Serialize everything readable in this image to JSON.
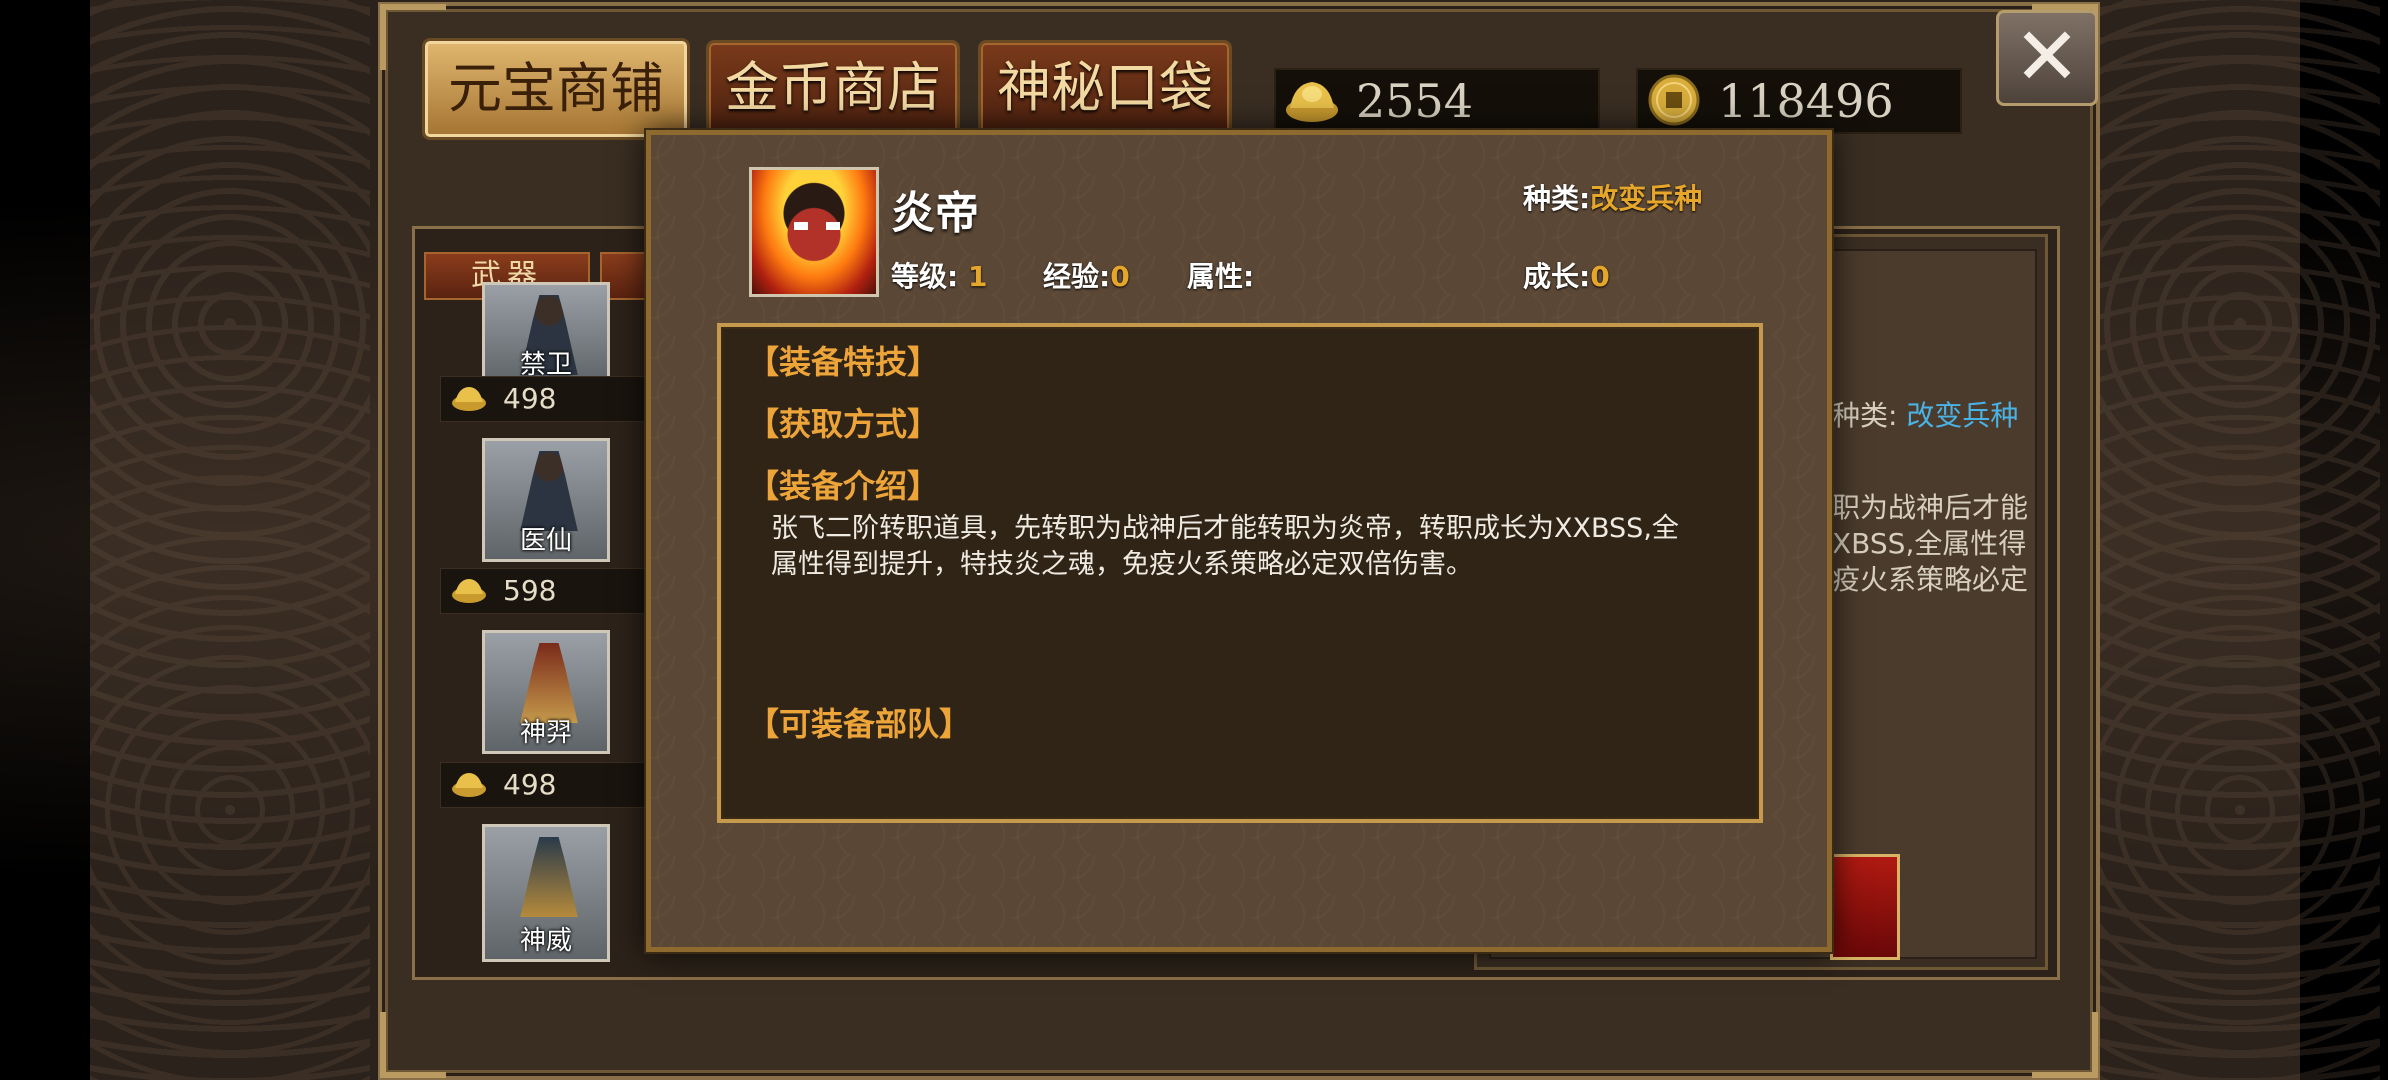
{
  "shop": {
    "tabs": [
      {
        "label": "元宝商铺",
        "active": true
      },
      {
        "label": "金币商店",
        "active": false
      },
      {
        "label": "神秘口袋",
        "active": false
      }
    ],
    "yuanbao": "2554",
    "gold_coins": "118496",
    "close_icon": "✕",
    "categories": [
      "武器"
    ],
    "items": [
      {
        "name": "禁卫",
        "price": "498"
      },
      {
        "name": "医仙",
        "price": "598"
      },
      {
        "name": "神羿",
        "price": "498"
      },
      {
        "name": "神威",
        "price": ""
      }
    ],
    "right_peek": {
      "type_label": "种类:",
      "type_value": "改变兵种",
      "lines": [
        "职为战神后才能",
        "XBSS,全属性得",
        "疫火系策略必定"
      ]
    }
  },
  "modal": {
    "name": "炎帝",
    "type_label": "种类:",
    "type_value": "改变兵种",
    "level_label": "等级:",
    "level_value": "1",
    "exp_label": "经验:",
    "exp_value": "0",
    "attr_label": "属性:",
    "attr_value": "",
    "growth_label": "成长:",
    "growth_value": "0",
    "sections": {
      "skill": "【装备特技】",
      "obtain": "【获取方式】",
      "intro": "【装备介绍】",
      "units": "【可装备部队】"
    },
    "description": "张飞二阶转职道具，先转职为战神后才能转职为炎帝，转职成长为XXBSS,全属性得到提升，特技炎之魂，免疫火系策略必定双倍伤害。"
  },
  "colors": {
    "accent_gold": "#e6a62a",
    "section_orange": "#eda53a",
    "peek_blue": "#4ab3e6"
  }
}
